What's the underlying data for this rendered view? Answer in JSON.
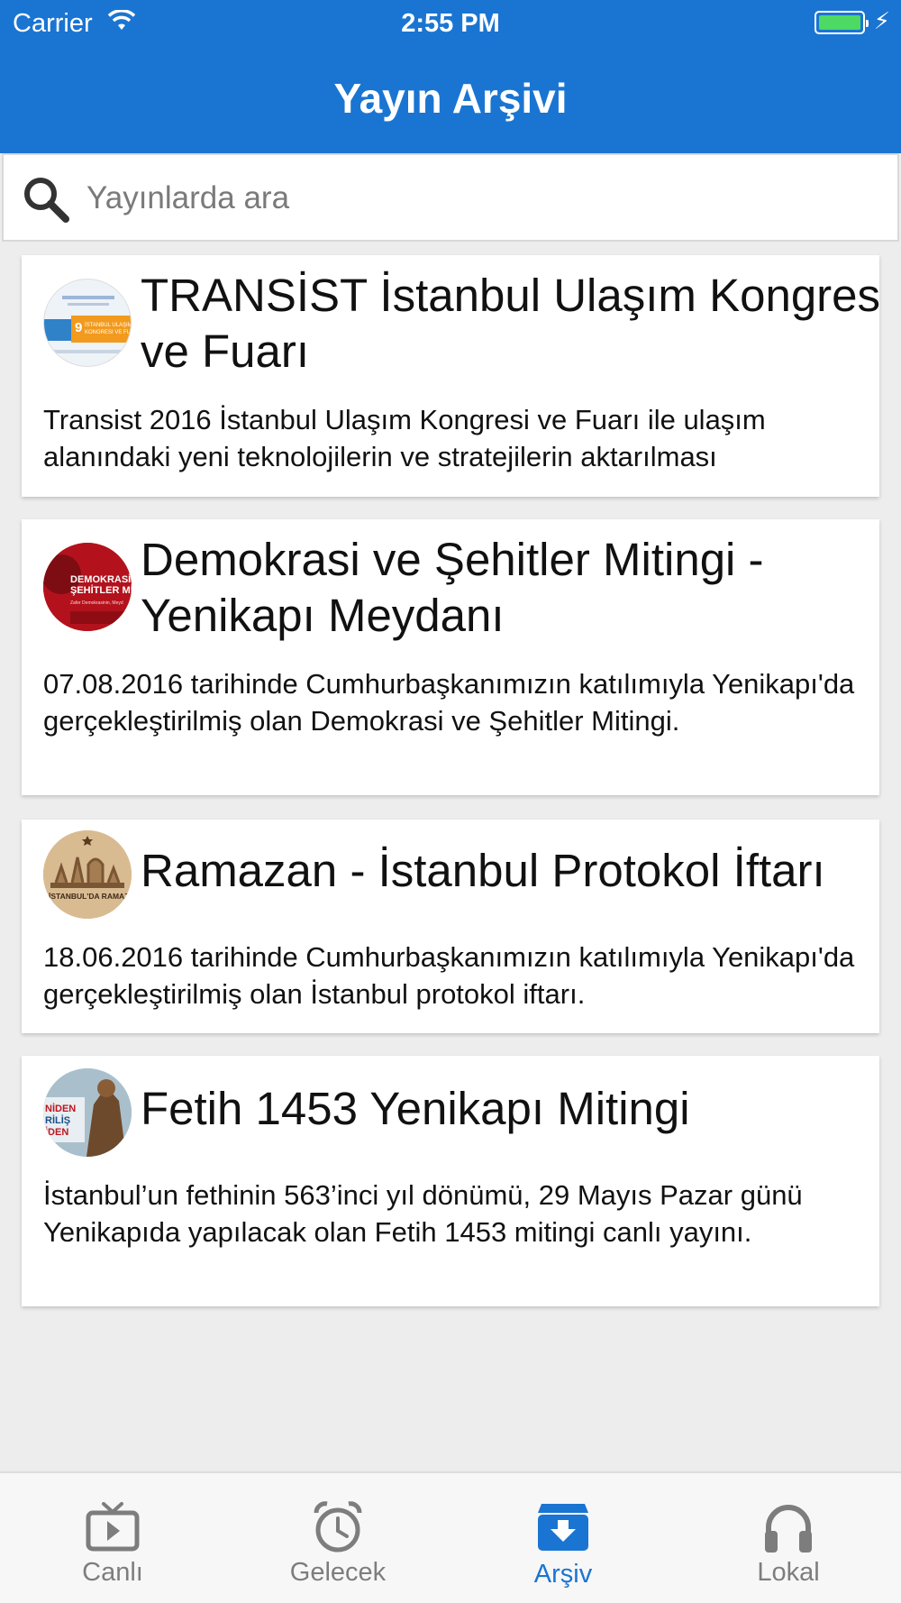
{
  "status_bar": {
    "carrier": "Carrier",
    "time": "2:55 PM"
  },
  "header": {
    "title": "Yayın Arşivi"
  },
  "search": {
    "placeholder": "Yayınlarda ara"
  },
  "items": [
    {
      "title": "TRANSİST İstanbul Ulaşım Kongresi ve Fuarı",
      "description": "Transist 2016 İstanbul Ulaşım Kongresi ve Fuarı ile ulaşım alanındaki yeni teknolojilerin ve stratejilerin aktarılması",
      "thumb_text": "İSTANBUL ULAŞIM KONGRESI VE FUARI"
    },
    {
      "title": "Demokrasi ve Şehitler Mitingi - Yenikapı Meydanı",
      "description": "07.08.2016 tarihinde  Cumhurbaşkanımızın katılımıyla Yenikapı'da gerçekleştirilmiş olan Demokrasi ve Şehitler Mitingi.",
      "thumb_text": "DEMOKRASİ ŞEHİTLER Mİ"
    },
    {
      "title": "Ramazan - İstanbul Protokol İftarı",
      "description": "18.06.2016 tarihinde Cumhurbaşkanımızın katılımıyla Yenikapı'da gerçekleştirilmiş olan İstanbul protokol iftarı.",
      "thumb_text": "İSTANBUL'DA RAMAZAN"
    },
    {
      "title": "Fetih 1453 Yenikapı Mitingi",
      "description": "İstanbul’un fethinin 563’inci yıl dönümü, 29 Mayıs Pazar günü Yenikapıda yapılacak olan Fetih 1453 mitingi canlı yayını.",
      "thumb_text": "NİDEN RİLİŞ"
    }
  ],
  "tabs": [
    {
      "label": "Canlı",
      "icon": "tv-icon"
    },
    {
      "label": "Gelecek",
      "icon": "alarm-clock-icon"
    },
    {
      "label": "Arşiv",
      "icon": "archive-icon",
      "active": true
    },
    {
      "label": "Lokal",
      "icon": "headphones-icon"
    }
  ],
  "colors": {
    "primary": "#1a75d2",
    "background": "#ededed",
    "tab_inactive": "#7d7d7d",
    "battery": "#4cd964"
  }
}
